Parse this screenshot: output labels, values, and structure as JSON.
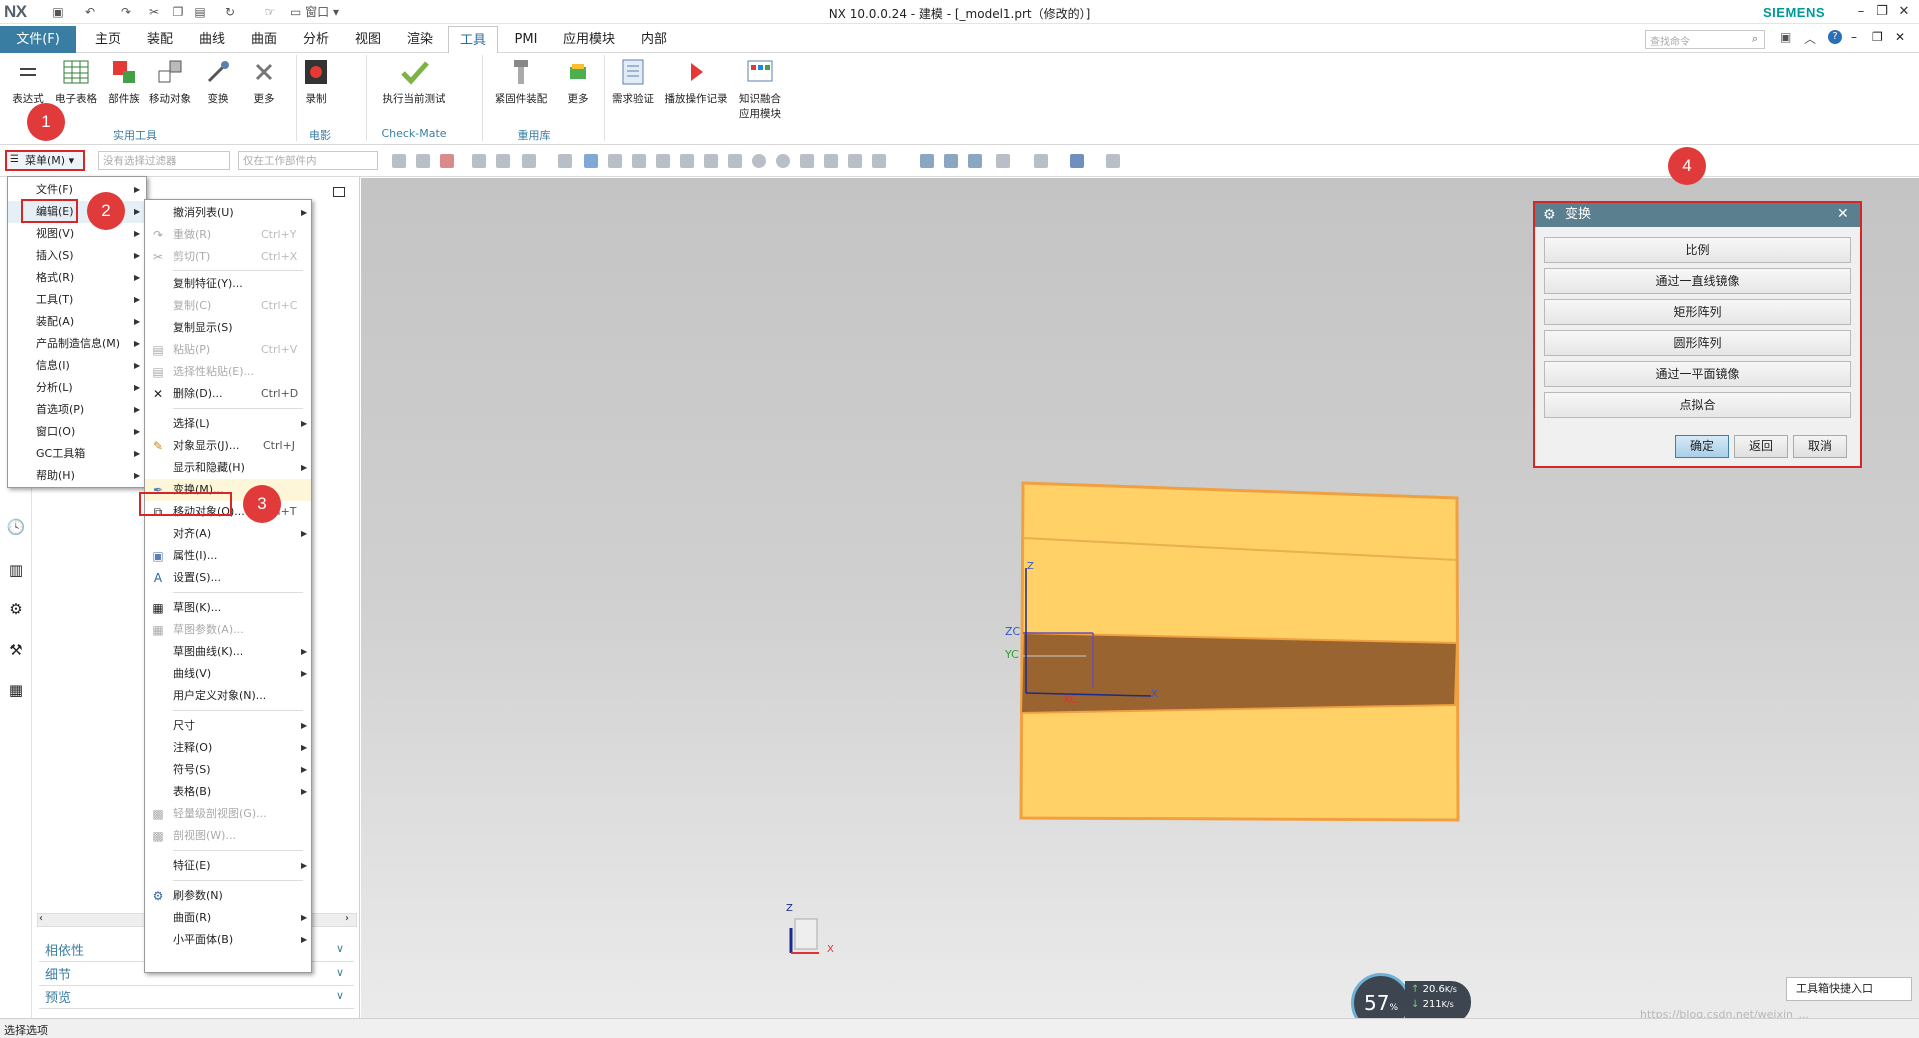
{
  "app": {
    "logo": "NX",
    "title": "NX 10.0.0.24 - 建模 - [_model1.prt（修改的）]",
    "brand": "SIEMENS",
    "window_menu": "窗口"
  },
  "ribbon_tabs": [
    "文件(F)",
    "主页",
    "装配",
    "曲线",
    "曲面",
    "分析",
    "视图",
    "渲染",
    "工具",
    "PMI",
    "应用模块",
    "内部"
  ],
  "active_tab": "工具",
  "command_search": {
    "placeholder": "查找命令"
  },
  "ribbon": {
    "buttons": [
      "表达式",
      "电子表格",
      "部件族",
      "移动对象",
      "变换",
      "更多",
      "录制",
      "执行当前测试",
      "紧固件装配",
      "更多",
      "需求验证",
      "播放操作记录",
      "知识融合应用模块"
    ],
    "groups": [
      "实用工具",
      "电影",
      "Check-Mate",
      "重用库"
    ]
  },
  "toolbar": {
    "menu_label": "菜单(M)",
    "filter_placeholder": "没有选择过滤器",
    "scope_placeholder": "仅在工作部件内"
  },
  "main_menu": {
    "items": [
      "文件(F)",
      "编辑(E)",
      "视图(V)",
      "插入(S)",
      "格式(R)",
      "工具(T)",
      "装配(A)",
      "产品制造信息(M)",
      "信息(I)",
      "分析(L)",
      "首选项(P)",
      "窗口(O)",
      "GC工具箱",
      "帮助(H)"
    ]
  },
  "edit_menu": {
    "items": [
      {
        "label": "撤消列表(U)",
        "shortcut": ""
      },
      {
        "label": "重做(R)",
        "shortcut": "Ctrl+Y"
      },
      {
        "label": "剪切(T)",
        "shortcut": "Ctrl+X"
      },
      {
        "label": "复制特征(Y)...",
        "shortcut": ""
      },
      {
        "label": "复制(C)",
        "shortcut": "Ctrl+C"
      },
      {
        "label": "复制显示(S)",
        "shortcut": ""
      },
      {
        "label": "粘贴(P)",
        "shortcut": "Ctrl+V"
      },
      {
        "label": "选择性粘贴(E)...",
        "shortcut": ""
      },
      {
        "label": "删除(D)...",
        "shortcut": "Ctrl+D"
      },
      {
        "label": "选择(L)",
        "shortcut": ""
      },
      {
        "label": "对象显示(J)...",
        "shortcut": "Ctrl+J"
      },
      {
        "label": "显示和隐藏(H)",
        "shortcut": ""
      },
      {
        "label": "变换(M)...",
        "shortcut": ""
      },
      {
        "label": "移动对象(O)...",
        "shortcut": "Ctrl+T"
      },
      {
        "label": "对齐(A)",
        "shortcut": ""
      },
      {
        "label": "属性(I)...",
        "shortcut": ""
      },
      {
        "label": "设置(S)...",
        "shortcut": ""
      },
      {
        "label": "草图(K)...",
        "shortcut": ""
      },
      {
        "label": "草图参数(A)...",
        "shortcut": ""
      },
      {
        "label": "草图曲线(K)...",
        "shortcut": ""
      },
      {
        "label": "曲线(V)",
        "shortcut": ""
      },
      {
        "label": "用户定义对象(N)...",
        "shortcut": ""
      },
      {
        "label": "尺寸",
        "shortcut": ""
      },
      {
        "label": "注释(O)",
        "shortcut": ""
      },
      {
        "label": "符号(S)",
        "shortcut": ""
      },
      {
        "label": "表格(B)",
        "shortcut": ""
      },
      {
        "label": "轻量级剖视图(G)...",
        "shortcut": ""
      },
      {
        "label": "剖视图(W)...",
        "shortcut": ""
      },
      {
        "label": "特征(E)",
        "shortcut": ""
      },
      {
        "label": "刷参数(N)",
        "shortcut": ""
      },
      {
        "label": "曲面(R)",
        "shortcut": ""
      },
      {
        "label": "小平面体(B)",
        "shortcut": ""
      }
    ]
  },
  "nav_sections": [
    "相依性",
    "细节",
    "预览"
  ],
  "dialog": {
    "title": "变换",
    "options": [
      "比例",
      "通过一直线镜像",
      "矩形阵列",
      "圆形阵列",
      "通过一平面镜像",
      "点拟合"
    ],
    "ok": "确定",
    "back": "返回",
    "cancel": "取消"
  },
  "steps": [
    "1",
    "2",
    "3",
    "4"
  ],
  "axes": {
    "zc": "ZC",
    "yc": "YC",
    "xc": "XC",
    "x": "X",
    "z": "Z"
  },
  "perf": {
    "cpu": "57",
    "pct": "%",
    "up": "20.6",
    "up_unit": "K/s",
    "down": "211",
    "down_unit": "K/s"
  },
  "toolbox_entry": "工具箱快捷入口",
  "status": "选择选项",
  "watermark": "https://blog.csdn.net/weixin_..."
}
